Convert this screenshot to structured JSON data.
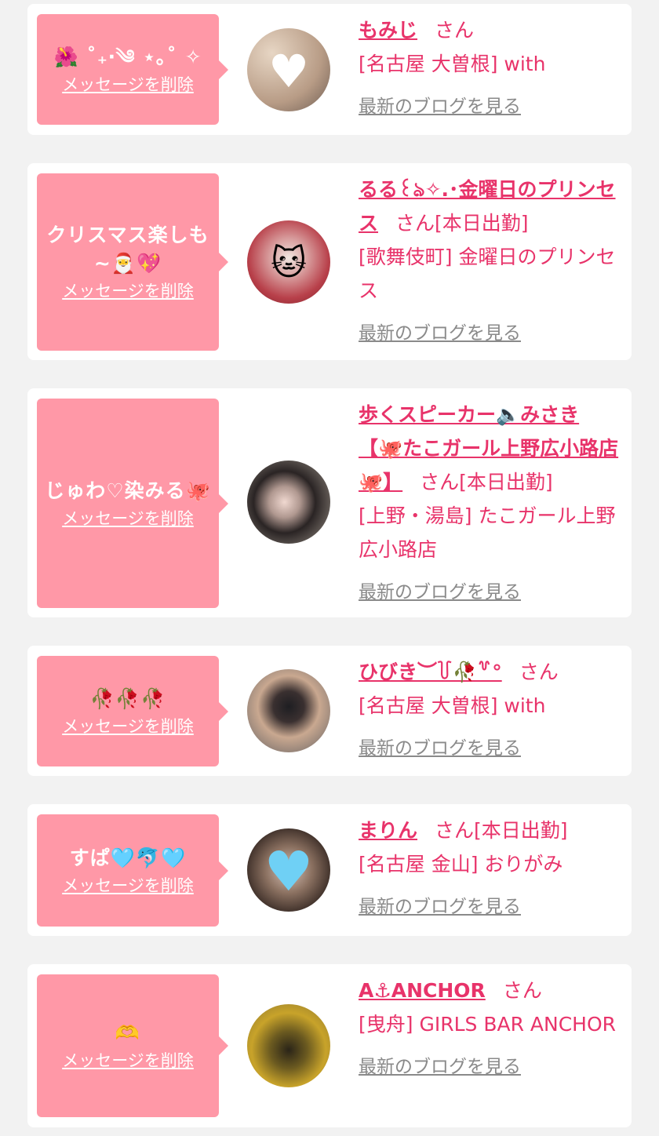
{
  "delete_label": "メッセージを削除",
  "blog_label": "最新のブログを見る",
  "san_label": "さん",
  "colors": {
    "accent": "#e8336a",
    "bubble": "#ff98a7",
    "bg": "#f2f2f2",
    "link_gray": "#8a8a8a"
  },
  "entries": [
    {
      "message": "🌺 ˚₊‧༄ ⋆｡˚ ✧",
      "name": "もみじ",
      "status": "",
      "shop": "[名古屋 大曽根] with"
    },
    {
      "message": "クリスマス楽しも~🎅💖",
      "name": "るる꒰ঌ✧.･金曜日のプリンセス",
      "status": "[本日出勤]",
      "shop": "[歌舞伎町] 金曜日のプリンセス"
    },
    {
      "message": "じゅわ♡染みる🐙",
      "name": "歩くスピーカー🔈みさき【🐙たこガール上野広小路店🐙】",
      "status": "[本日出勤]",
      "shop": "[上野・湯島] たこガール上野広小路店"
    },
    {
      "message": "🥀🥀🥀",
      "name": "ひびき︶꒦🥀꒷°",
      "status": "",
      "shop": "[名古屋 大曽根] with"
    },
    {
      "message": "すぱ🩵🐬🩵",
      "name": "まりん",
      "status": "[本日出勤]",
      "shop": "[名古屋 金山] おりがみ"
    },
    {
      "message": "🫶",
      "name": "A⚓ANCHOR",
      "status": "",
      "shop": "[曳舟] GIRLS BAR ANCHOR"
    }
  ]
}
